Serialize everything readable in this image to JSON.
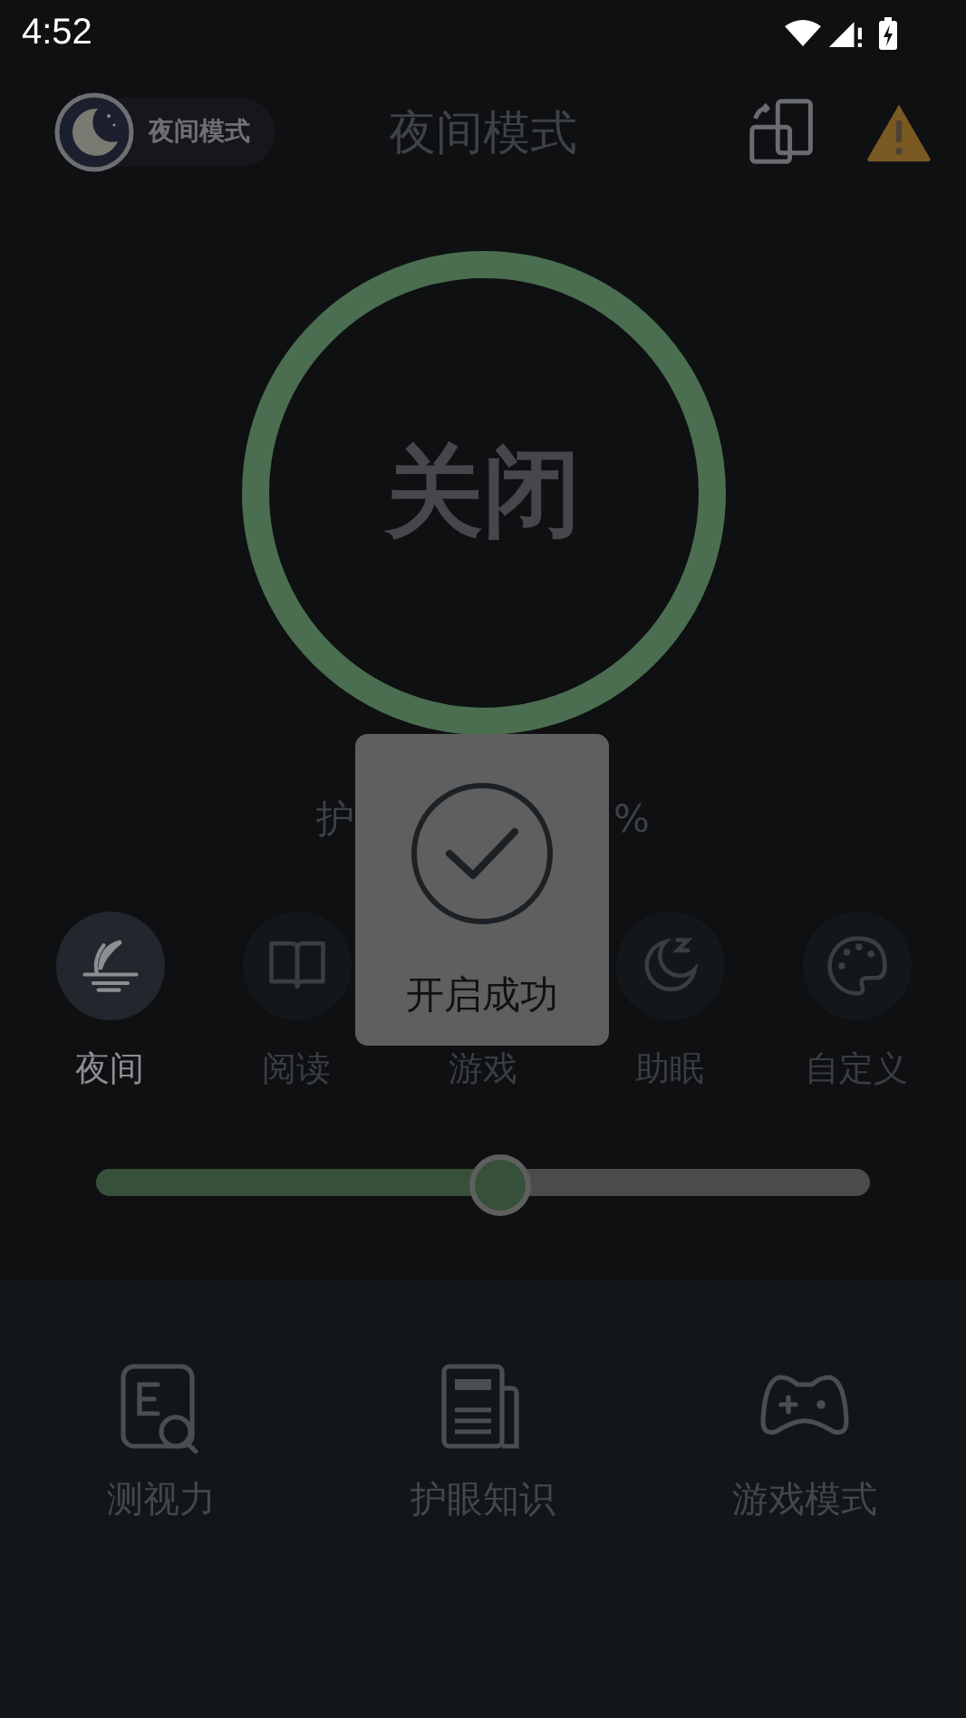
{
  "status_bar": {
    "time": "4:52"
  },
  "header": {
    "badge": "夜间模式",
    "title": "夜间模式"
  },
  "ring": {
    "label": "关闭",
    "on": false
  },
  "intensity": {
    "visible_start": "护",
    "visible_end": "%"
  },
  "modes": [
    {
      "label": "夜间",
      "kind": "moon",
      "selected": true
    },
    {
      "label": "阅读",
      "kind": "book",
      "selected": false
    },
    {
      "label": "游戏",
      "kind": "covered",
      "selected": false
    },
    {
      "label": "助眠",
      "kind": "sleep",
      "selected": false
    },
    {
      "label": "自定义",
      "kind": "palette",
      "selected": false
    }
  ],
  "slider": {
    "level": 0.52
  },
  "tools": [
    {
      "label": "测视力",
      "kind": "chart"
    },
    {
      "label": "护眼知识",
      "kind": "paper"
    },
    {
      "label": "游戏模式",
      "kind": "pad"
    }
  ],
  "toast": {
    "text": "开启成功"
  }
}
